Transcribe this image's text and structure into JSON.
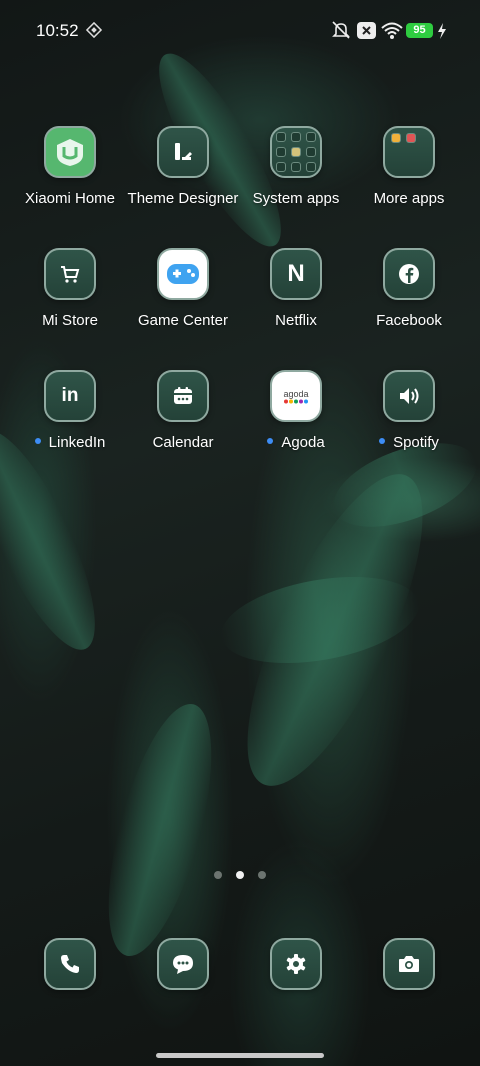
{
  "status_bar": {
    "time": "10:52",
    "battery_level": "95",
    "icons": [
      "vpn-icon",
      "mute-icon",
      "close-icon",
      "wifi-icon",
      "battery-icon",
      "charging-icon"
    ]
  },
  "apps": [
    {
      "label": "Xiaomi Home",
      "icon": "xiaomi-home-icon",
      "has_dot": false
    },
    {
      "label": "Theme Designer",
      "icon": "theme-designer-icon",
      "has_dot": false
    },
    {
      "label": "System apps",
      "icon": "folder-icon",
      "has_dot": false
    },
    {
      "label": "More apps",
      "icon": "folder-icon",
      "has_dot": false
    },
    {
      "label": "Mi Store",
      "icon": "cart-icon",
      "has_dot": false
    },
    {
      "label": "Game Center",
      "icon": "gamepad-icon",
      "has_dot": false
    },
    {
      "label": "Netflix",
      "icon": "netflix-icon",
      "has_dot": false
    },
    {
      "label": "Facebook",
      "icon": "facebook-icon",
      "has_dot": false
    },
    {
      "label": "LinkedIn",
      "icon": "linkedin-icon",
      "has_dot": true
    },
    {
      "label": "Calendar",
      "icon": "calendar-icon",
      "has_dot": false
    },
    {
      "label": "Agoda",
      "icon": "agoda-icon",
      "has_dot": true
    },
    {
      "label": "Spotify",
      "icon": "speaker-icon",
      "has_dot": true
    }
  ],
  "agoda_logo_text": "agoda",
  "netflix_letter": "N",
  "linkedin_text": "in",
  "page_indicator": {
    "count": 3,
    "active_index": 1
  },
  "dock": [
    {
      "icon": "phone-icon"
    },
    {
      "icon": "message-icon"
    },
    {
      "icon": "settings-icon"
    },
    {
      "icon": "camera-icon"
    }
  ],
  "colors": {
    "accent_battery": "#2ecc40",
    "notification_dot": "#3d8df5",
    "tile_bg": "#2f5448"
  }
}
